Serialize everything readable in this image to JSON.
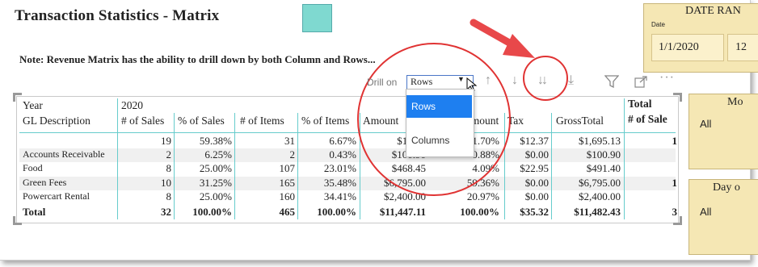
{
  "title": "Transaction Statistics - Matrix",
  "note": "Note: Revenue Matrix has the ability to drill down by both Column and Rows...",
  "date_panel": {
    "title": "DATE RAN",
    "label": "Date",
    "start": "1/1/2020",
    "end_partial": "12"
  },
  "slicer1": {
    "title": "Mo",
    "value": "All"
  },
  "slicer2": {
    "title": "Day o",
    "value": "All"
  },
  "toolbar": {
    "drill_label": "Drill on",
    "drill_value": "Rows",
    "drill_options": [
      "Rows",
      "Columns"
    ],
    "icons": [
      "drill-up-icon",
      "drill-down-icon",
      "expand-next-level-icon",
      "expand-all-icon",
      "filter-icon",
      "focus-mode-icon",
      "more-options-icon"
    ]
  },
  "matrix": {
    "year_label": "Year",
    "year_value": "2020",
    "row_header": "GL Description",
    "columns": [
      "# of Sales",
      "% of Sales",
      "# of Items",
      "% of Items",
      "Amount",
      "% of Amount",
      "Tax",
      "GrossTotal"
    ],
    "columns_display": [
      "# of Sales",
      "% of Sales",
      "# of Items",
      "% of Items",
      "Amount",
      "Amount",
      "Tax",
      "GrossTotal"
    ],
    "total_header": [
      "Total",
      "# of Sale"
    ],
    "rows": [
      {
        "label": "",
        "values": [
          "19",
          "59.38%",
          "31",
          "6.67%",
          "$1,682",
          "1.70%",
          "$12.37",
          "$1,695.13"
        ],
        "total": "1"
      },
      {
        "label": "Accounts Receivable",
        "values": [
          "2",
          "6.25%",
          "2",
          "0.43%",
          "$100.90",
          "0.88%",
          "$0.00",
          "$100.90"
        ],
        "total": ""
      },
      {
        "label": "Food",
        "values": [
          "8",
          "25.00%",
          "107",
          "23.01%",
          "$468.45",
          "4.09%",
          "$22.95",
          "$491.40"
        ],
        "total": ""
      },
      {
        "label": "Green Fees",
        "values": [
          "10",
          "31.25%",
          "165",
          "35.48%",
          "$6,795.00",
          "59.36%",
          "$0.00",
          "$6,795.00"
        ],
        "total": "1"
      },
      {
        "label": "Powercart Rental",
        "values": [
          "8",
          "25.00%",
          "160",
          "34.41%",
          "$2,400.00",
          "20.97%",
          "$0.00",
          "$2,400.00"
        ],
        "total": ""
      }
    ],
    "total_row": {
      "label": "Total",
      "values": [
        "32",
        "100.00%",
        "465",
        "100.00%",
        "$11,447.11",
        "100.00%",
        "$35.32",
        "$11,482.43"
      ],
      "total": "3"
    }
  },
  "accent_red": "#e03333",
  "accent_teal": "#66cccc",
  "slicer_bg": "#f5e7b4",
  "dropdown_selected_bg": "#1e7ff0"
}
